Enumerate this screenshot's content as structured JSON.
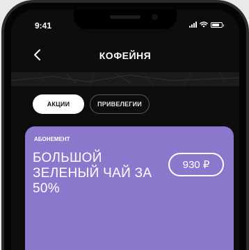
{
  "status_bar": {
    "time": "9:41"
  },
  "header": {
    "title": "КОФЕЙНЯ",
    "back_icon": "chevron-left-icon"
  },
  "tabs": [
    {
      "label": "АКЦИИ",
      "active": true
    },
    {
      "label": "ПРИВЕЛЕГИИ",
      "active": false
    }
  ],
  "promo": {
    "kicker": "АБОНЕМЕНТ",
    "title": "БОЛЬШОЙ ЗЕЛЕНЫЙ ЧАЙ ЗА 50%",
    "price": "930 ₽",
    "background": "#8b78cc"
  },
  "colors": {
    "screen": "#0d0d0d",
    "accent": "#8b78cc"
  }
}
